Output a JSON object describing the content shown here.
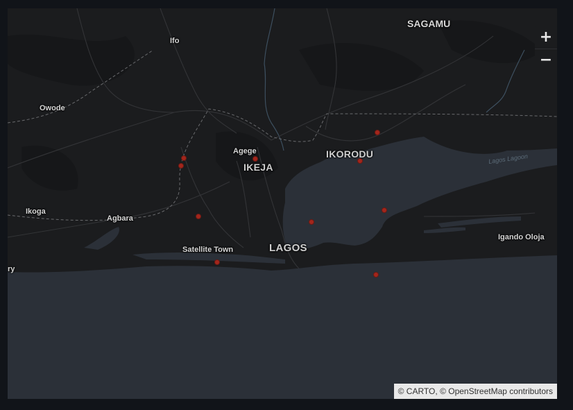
{
  "map": {
    "labels": {
      "sagamu": "SAGAMU",
      "ifo": "Ifo",
      "owode": "Owode",
      "agege": "Agege",
      "ikeja": "IKEJA",
      "ikorodu": "IKORODU",
      "ikoga": "Ikoga",
      "agbara": "Agbara",
      "satellite_town": "Satellite Town",
      "lagos": "LAGOS",
      "igando_oloja": "Igando Oloja",
      "left_edge": "ry",
      "lagoon": "Lagos Lagoon"
    },
    "markers_count": 10,
    "colors": {
      "land": "#1b1c1e",
      "water": "#2b3038",
      "marker": "#a3261c",
      "roads": "#3a3b3e",
      "borders": "#5a5b5e"
    }
  },
  "zoom": {
    "in_label": "+",
    "out_label": "−"
  },
  "attribution": {
    "carto": "© CARTO",
    "separator": ",",
    "osm": "© OpenStreetMap",
    "contributors": "contributors"
  }
}
